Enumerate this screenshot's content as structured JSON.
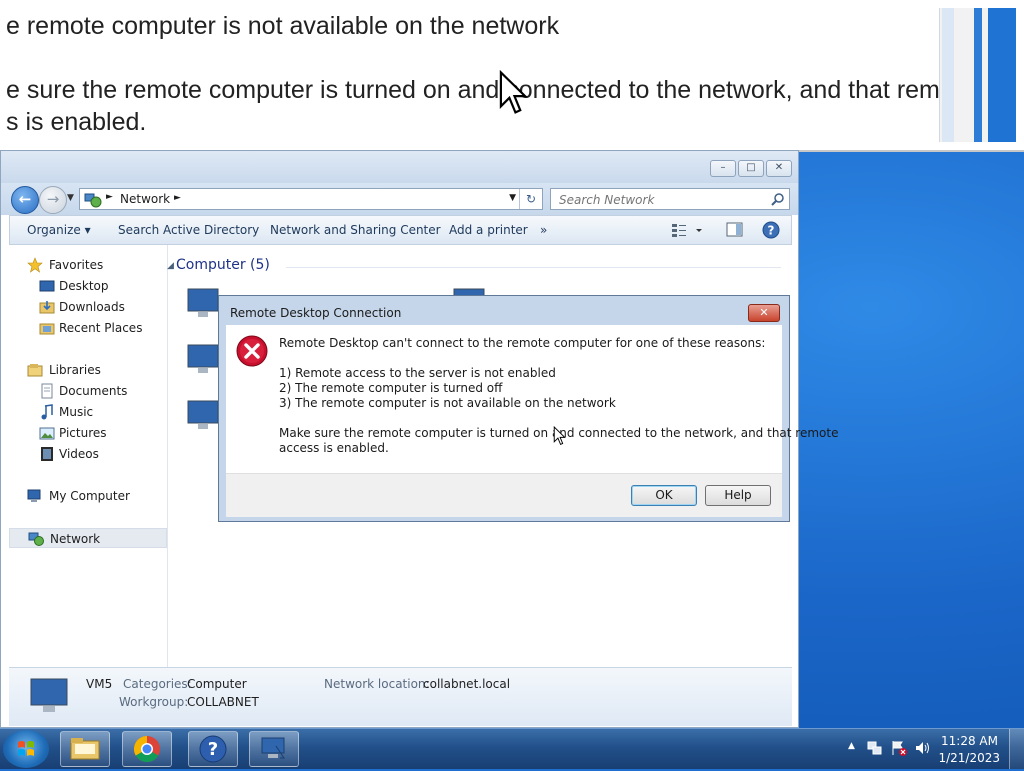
{
  "zoom": {
    "line1": "e remote computer is not available on the network",
    "line2": "e sure the remote computer is turned on and connected to the network, and that remote",
    "line3": "s is enabled."
  },
  "explorer": {
    "address": {
      "crumb": "Network"
    },
    "search": {
      "placeholder": "Search Network"
    },
    "window_buttons": {
      "minimize": "–",
      "maximize": "□",
      "close": "✕"
    },
    "toolbar": {
      "organize": "Organize ▾",
      "search_ad": "Search Active Directory",
      "net_center": "Network and Sharing Center",
      "add_printer": "Add a printer",
      "more": "»"
    },
    "nav": {
      "favorites": "Favorites",
      "desktop": "Desktop",
      "downloads": "Downloads",
      "recent": "Recent Places",
      "libraries": "Libraries",
      "documents": "Documents",
      "music": "Music",
      "pictures": "Pictures",
      "videos": "Videos",
      "my_computer": "My Computer",
      "network": "Network"
    },
    "content": {
      "group_header": "Computer (5)"
    },
    "details": {
      "name": "VM5",
      "categories_label": "Categories:",
      "categories_value": "Computer",
      "workgroup_label": "Workgroup:",
      "workgroup_value": "COLLABNET",
      "location_label": "Network location:",
      "location_value": "collabnet.local"
    }
  },
  "dialog": {
    "title": "Remote Desktop Connection",
    "close": "✕",
    "intro": "Remote Desktop can't connect to the remote computer for one of these reasons:",
    "reasons": [
      "1) Remote access to the server is not enabled",
      "2) The remote computer is turned off",
      "3) The remote computer is not available on the network"
    ],
    "advice_line1": "Make sure the remote computer is turned on and connected to the network, and that remote",
    "advice_line2": "access is enabled.",
    "ok": "OK",
    "help": "Help"
  },
  "taskbar": {
    "apps": [
      "windows-explorer-icon",
      "chrome-icon",
      "help-icon",
      "network-rdp-icon"
    ],
    "time": "11:28 AM",
    "date": "1/21/2023"
  },
  "colors": {
    "desktop": "#1a66c8",
    "window_chrome": "#c9d9ec",
    "link_blue": "#1e3287",
    "error_red": "#c8102e"
  }
}
